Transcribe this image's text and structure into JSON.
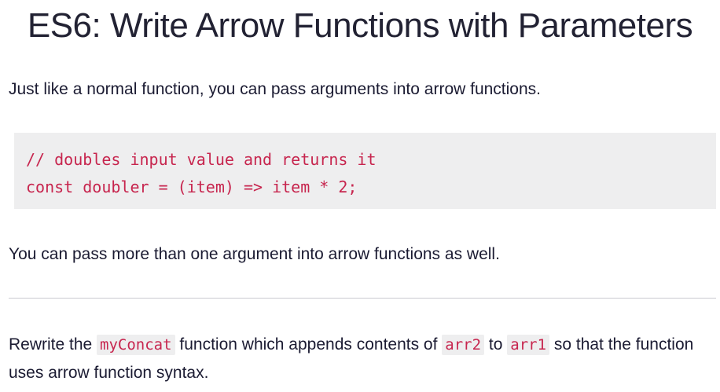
{
  "challenge": {
    "title": "ES6: Write Arrow Functions with Parameters",
    "intro": "Just like a normal function, you can pass arguments into arrow functions.",
    "code_lines": [
      "// doubles input value and returns it",
      "const doubler = (item) => item * 2;"
    ],
    "more_args": "You can pass more than one argument into arrow functions as well.",
    "instructions": {
      "part1": "Rewrite the ",
      "code1": "myConcat",
      "part2": " function which appends contents of ",
      "code2": "arr2",
      "part3": " to ",
      "code3": "arr1",
      "part4": " so that the function uses arrow function syntax."
    }
  },
  "colors": {
    "code_text": "#c7254e",
    "code_background": "#eeeeef",
    "body_text": "#1b1b32",
    "divider": "#c9c9cf"
  }
}
